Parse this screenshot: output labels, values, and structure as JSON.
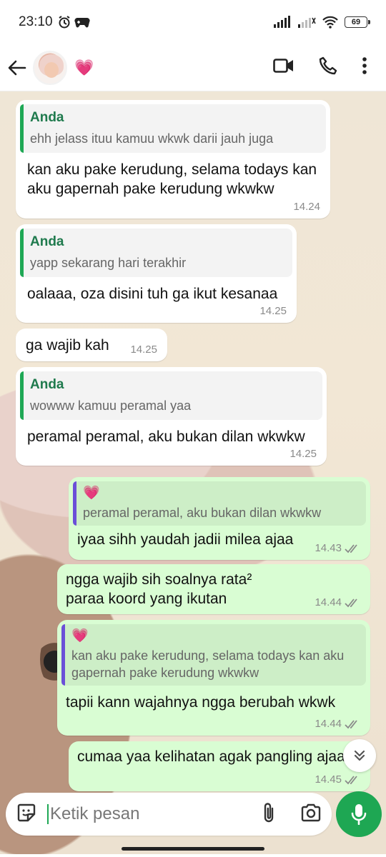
{
  "status": {
    "time": "23:10",
    "battery": "69"
  },
  "header": {
    "heart_emoji": "💗"
  },
  "messages": [
    {
      "quote_author": "Anda",
      "quote_text": "ehh jelass ituu kamuu wkwk darii jauh juga",
      "text": "kan aku pake kerudung, selama todays kan aku gapernah pake kerudung wkwkw",
      "time": "14.24"
    },
    {
      "quote_author": "Anda",
      "quote_text": "yapp sekarang hari terakhir",
      "text": "oalaaa, oza disini tuh ga ikut kesanaa",
      "time": "14.25"
    },
    {
      "text": "ga wajib kah",
      "time": "14.25"
    },
    {
      "quote_author": "Anda",
      "quote_text": "wowww kamuu peramal yaa",
      "text": "peramal peramal, aku bukan dilan wkwkw",
      "time": "14.25"
    },
    {
      "quote_author": "💗",
      "quote_text": "peramal peramal, aku bukan dilan wkwkw",
      "text": "iyaa sihh yaudah jadii milea ajaa",
      "time": "14.43"
    },
    {
      "text": "ngga wajib sih soalnya rata² paraa koord yang ikutan",
      "time": "14.44"
    },
    {
      "quote_author": "💗",
      "quote_text": "kan aku pake kerudung, selama todays kan aku gapernah pake kerudung wkwkw",
      "text": "tapii kann wajahnya ngga berubah wkwk",
      "time": "14.44"
    },
    {
      "text": "cumaa yaa kelihatan agak pangling ajaa",
      "time": "14.45"
    }
  ],
  "input": {
    "placeholder": "Ketik pesan"
  },
  "colors": {
    "accent": "#1ea753",
    "outgoing_bubble": "#d9fdd3",
    "incoming_bubble": "#ffffff"
  }
}
